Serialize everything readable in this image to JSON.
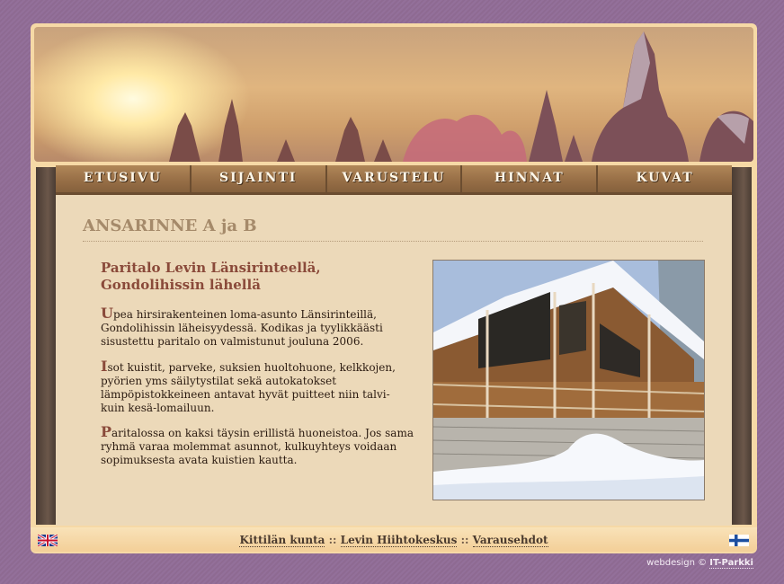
{
  "nav": {
    "items": [
      {
        "label": "ETUSIVU"
      },
      {
        "label": "SIJAINTI"
      },
      {
        "label": "VARUSTELU"
      },
      {
        "label": "HINNAT"
      },
      {
        "label": "KUVAT"
      }
    ]
  },
  "main": {
    "title": "ANSARINNE A ja B",
    "subtitle": "Paritalo Levin Länsirinteellä, Gondolihissin lähellä",
    "paragraphs": [
      {
        "initial": "U",
        "text": "pea hirsirakenteinen loma-asunto Länsirinteillä, Gondolihissin läheisyydessä. Kodikas ja tyylikkäästi sisustettu paritalo on valmistunut jouluna 2006."
      },
      {
        "initial": "I",
        "text": "sot kuistit, parveke, suksien huoltohuone, kelkkojen, pyörien yms säilytystilat sekä autokatokset lämpöpistokkeineen antavat hyvät puitteet niin talvi- kuin kesä-lomailuun."
      },
      {
        "initial": "P",
        "text": "aritalossa on kaksi täysin erillistä huoneistoa. Jos sama ryhmä varaa molemmat asunnot, kulkuyhteys voidaan sopimuksesta avata kuistien kautta."
      }
    ]
  },
  "footer": {
    "links": [
      "Kittilän kunta",
      "Levin Hiihtokeskus",
      "Varausehdot"
    ],
    "separator": "::"
  },
  "credit": {
    "prefix": "webdesign ©",
    "link": "IT-Parkki"
  },
  "colors": {
    "accent": "#8a4a3a",
    "nav_bg": "#9a7148",
    "frame": "#f6d9a6",
    "content_bg": "#ecd9b9"
  }
}
